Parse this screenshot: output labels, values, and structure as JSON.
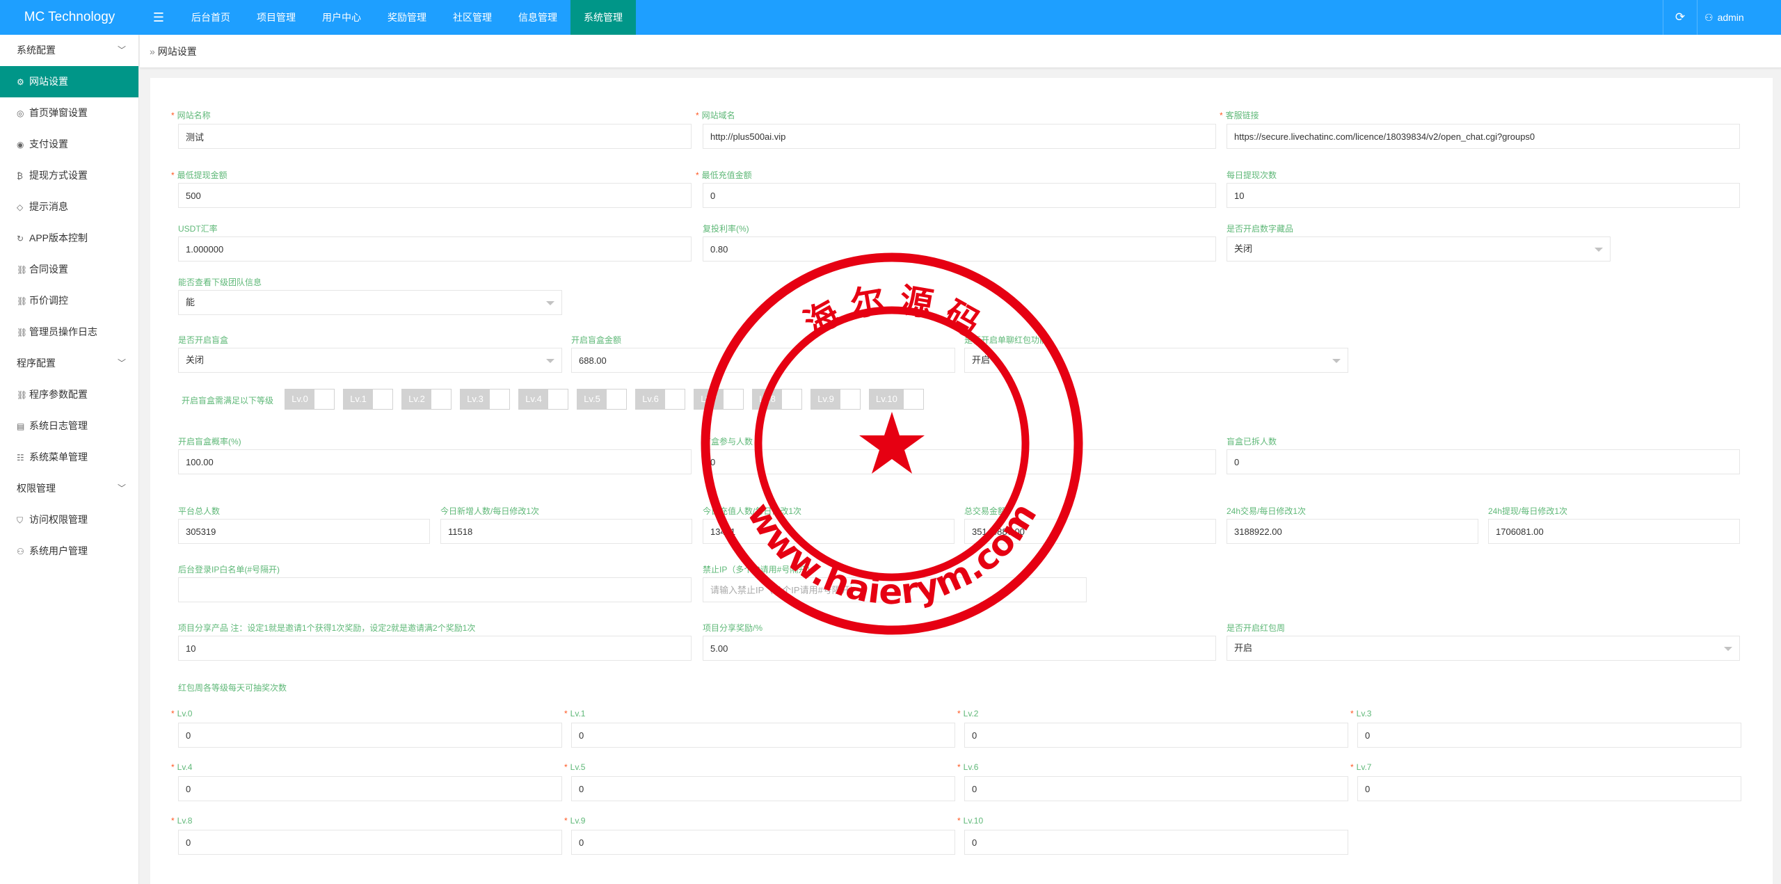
{
  "app": {
    "brand": "MC Technology",
    "user": "admin"
  },
  "topnav": [
    "后台首页",
    "项目管理",
    "用户中心",
    "奖励管理",
    "社区管理",
    "信息管理",
    "系统管理"
  ],
  "sidebar": {
    "groups": [
      {
        "label": "系统配置",
        "items": [
          {
            "label": "网站设置",
            "icon": "gear-icon"
          },
          {
            "label": "首页弹窗设置",
            "icon": "eye-icon"
          },
          {
            "label": "支付设置",
            "icon": "payment-icon"
          },
          {
            "label": "提现方式设置",
            "icon": "bitcoin-icon"
          },
          {
            "label": "提示消息",
            "icon": "tag-icon"
          },
          {
            "label": "APP版本控制",
            "icon": "refresh-icon"
          },
          {
            "label": "合同设置",
            "icon": "link-icon"
          },
          {
            "label": "币价调控",
            "icon": "link-icon"
          },
          {
            "label": "管理员操作日志",
            "icon": "link-icon"
          }
        ]
      },
      {
        "label": "程序配置",
        "items": [
          {
            "label": "程序参数配置",
            "icon": "link-icon"
          },
          {
            "label": "系统日志管理",
            "icon": "log-icon"
          },
          {
            "label": "系统菜单管理",
            "icon": "menu-icon"
          }
        ]
      },
      {
        "label": "权限管理",
        "items": [
          {
            "label": "访问权限管理",
            "icon": "shield-icon"
          },
          {
            "label": "系统用户管理",
            "icon": "user-icon"
          }
        ]
      }
    ]
  },
  "breadcrumb": "网站设置",
  "form": {
    "site_name": {
      "label": "网站名称",
      "value": "测试"
    },
    "site_domain": {
      "label": "网站域名",
      "value": "http://plus500ai.vip"
    },
    "service_link": {
      "label": "客服链接",
      "value": "https://secure.livechatinc.com/licence/18039834/v2/open_chat.cgi?groups0"
    },
    "min_withdraw": {
      "label": "最低提现金额",
      "value": "500"
    },
    "min_recharge": {
      "label": "最低充值金额",
      "value": "0"
    },
    "daily_withdraw_times": {
      "label": "每日提现次数",
      "value": "10"
    },
    "usdt_rate": {
      "label": "USDT汇率",
      "value": "1.000000"
    },
    "reinvest_rate": {
      "label": "复投利率(%)",
      "value": "0.80"
    },
    "digital_collection": {
      "label": "是否开启数字藏品",
      "value": "关闭"
    },
    "view_team_info": {
      "label": "能否查看下级团队信息",
      "value": "能"
    },
    "blind_box_open": {
      "label": "是否开启盲盒",
      "value": "关闭"
    },
    "blind_box_amount": {
      "label": "开启盲盒金额",
      "value": "688.00"
    },
    "single_red_packet": {
      "label": "是否开启单聊红包功能",
      "value": "开启"
    },
    "blind_box_levels_label": "开启盲盒需满足以下等级",
    "levels": [
      "Lv.0",
      "Lv.1",
      "Lv.2",
      "Lv.3",
      "Lv.4",
      "Lv.5",
      "Lv.6",
      "Lv.7",
      "Lv.8",
      "Lv.9",
      "Lv.10"
    ],
    "blind_box_prob": {
      "label": "开启盲盒概率(%)",
      "value": "100.00"
    },
    "blind_box_participants": {
      "label": "盲盒参与人数",
      "value": "0"
    },
    "blind_box_opened": {
      "label": "盲盒已拆人数",
      "value": "0"
    },
    "platform_total": {
      "label": "平台总人数",
      "value": "305319"
    },
    "today_new": {
      "label": "今日新增人数/每日修改1次",
      "value": "11518"
    },
    "today_recharge": {
      "label": "今日充值人数/每日修改1次",
      "value": "13431"
    },
    "total_trade": {
      "label": "总交易金额",
      "value": "35144887.00"
    },
    "trade_24h": {
      "label": "24h交易/每日修改1次",
      "value": "3188922.00"
    },
    "withdraw_24h": {
      "label": "24h提现/每日修改1次",
      "value": "1706081.00"
    },
    "ip_whitelist": {
      "label": "后台登录IP白名单(#号隔开)",
      "value": ""
    },
    "ip_ban": {
      "label": "禁止IP（多个IP请用#号隔开）",
      "placeholder": "请输入禁止IP（多个IP请用#号隔开）"
    },
    "share_product": {
      "label": "项目分享产品 注：设定1就是邀请1个获得1次奖励，设定2就是邀请满2个奖励1次",
      "value": "10"
    },
    "share_reward": {
      "label": "项目分享奖励/%",
      "value": "5.00"
    },
    "red_packet_week": {
      "label": "是否开启红包周",
      "value": "开启"
    },
    "red_packet_levels_title": "红包周各等级每天可抽奖次数",
    "red_packet_levels": [
      {
        "label": "Lv.0",
        "value": "0"
      },
      {
        "label": "Lv.1",
        "value": "0"
      },
      {
        "label": "Lv.2",
        "value": "0"
      },
      {
        "label": "Lv.3",
        "value": "0"
      },
      {
        "label": "Lv.4",
        "value": "0"
      },
      {
        "label": "Lv.5",
        "value": "0"
      },
      {
        "label": "Lv.6",
        "value": "0"
      },
      {
        "label": "Lv.7",
        "value": "0"
      },
      {
        "label": "Lv.8",
        "value": "0"
      },
      {
        "label": "Lv.9",
        "value": "0"
      },
      {
        "label": "Lv.10",
        "value": "0"
      }
    ]
  },
  "watermark": {
    "top_text": "海 尔 源 码",
    "bottom_text": "www.haierym.com",
    "color": "#e60012"
  },
  "colors": {
    "topbar": "#1E9FFF",
    "active": "#009688",
    "label": "#5FB878",
    "required": "#FF5722"
  }
}
